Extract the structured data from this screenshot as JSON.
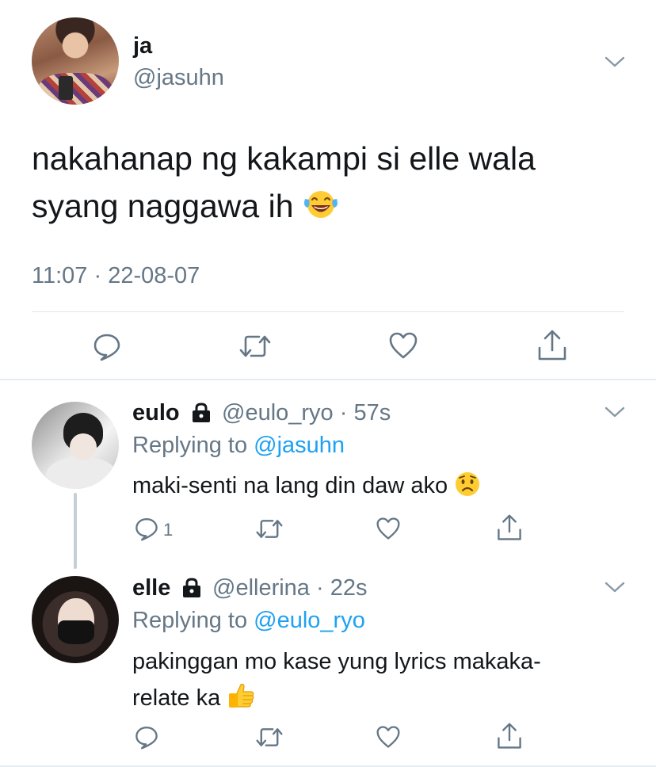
{
  "main_tweet": {
    "display_name": "ja",
    "handle": "@jasuhn",
    "text": "nakahanap ng kakampi si elle wala syang naggawa ih",
    "emoji": "face-with-tears-of-joy",
    "timestamp": "11:07 · 22-08-07"
  },
  "replies": [
    {
      "display_name": "eulo",
      "locked": true,
      "handle": "@eulo_ryo",
      "separator": "·",
      "time": "57s",
      "replying_prefix": "Replying to",
      "replying_to": "@jasuhn",
      "text": "maki-senti na lang din daw ako",
      "emoji": "worried-face",
      "reply_count": "1"
    },
    {
      "display_name": "elle",
      "locked": true,
      "handle": "@ellerina",
      "separator": "·",
      "time": "22s",
      "replying_prefix": "Replying to",
      "replying_to": "@eulo_ryo",
      "text_line1": "pakinggan mo kase yung lyrics makaka-",
      "text_line2": "relate ka",
      "emoji": "thumbs-up",
      "reply_count": ""
    }
  ],
  "colors": {
    "text": "#14171a",
    "muted": "#657786",
    "accent": "#1da1f2",
    "divider": "#e1e8ed",
    "icon": "#657786"
  }
}
